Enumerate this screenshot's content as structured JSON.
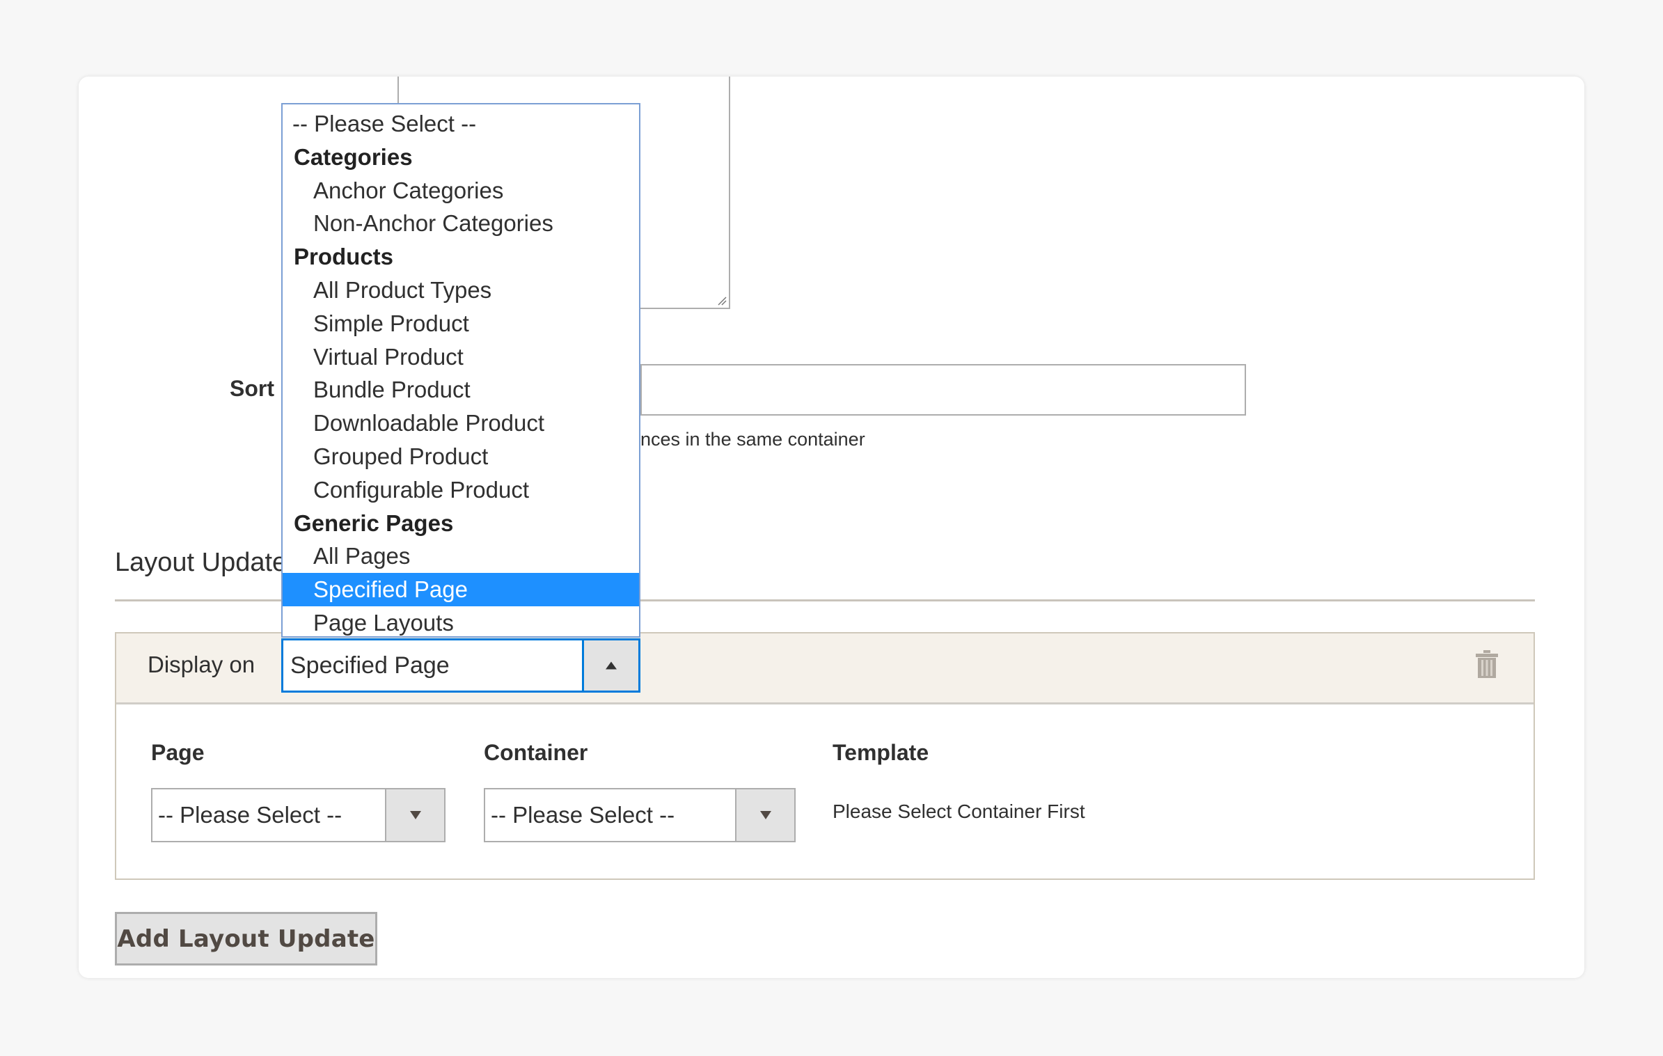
{
  "form": {
    "sort_label": "Sort",
    "sort_value": "",
    "sort_note": "nces in the same container"
  },
  "layout_updates": {
    "section_title": "Layout Updates",
    "display_on_label": "Display on",
    "display_on_value": "Specified Page",
    "dropdown_open": true,
    "dropdown_options": [
      {
        "label": "-- Please Select --",
        "kind": "placeholder"
      },
      {
        "label": "Categories",
        "kind": "group"
      },
      {
        "label": "Anchor Categories",
        "kind": "child"
      },
      {
        "label": "Non-Anchor Categories",
        "kind": "child"
      },
      {
        "label": "Products",
        "kind": "group"
      },
      {
        "label": "All Product Types",
        "kind": "child"
      },
      {
        "label": "Simple Product",
        "kind": "child"
      },
      {
        "label": "Virtual Product",
        "kind": "child"
      },
      {
        "label": "Bundle Product",
        "kind": "child"
      },
      {
        "label": "Downloadable Product",
        "kind": "child"
      },
      {
        "label": "Grouped Product",
        "kind": "child"
      },
      {
        "label": "Configurable Product",
        "kind": "child"
      },
      {
        "label": "Generic Pages",
        "kind": "group"
      },
      {
        "label": "All Pages",
        "kind": "child"
      },
      {
        "label": "Specified Page",
        "kind": "child",
        "selected": true
      },
      {
        "label": "Page Layouts",
        "kind": "child"
      }
    ],
    "page_label": "Page",
    "page_value": "-- Please Select --",
    "container_label": "Container",
    "container_value": "-- Please Select --",
    "template_label": "Template",
    "template_note": "Please Select Container First",
    "delete_icon": "trash-icon",
    "add_button_label": "Add Layout Update"
  },
  "colors": {
    "highlight": "#1e90ff",
    "focus_border": "#007bdb",
    "panel_bg": "#f5f1ea",
    "button_bg": "#e3e3e3"
  }
}
